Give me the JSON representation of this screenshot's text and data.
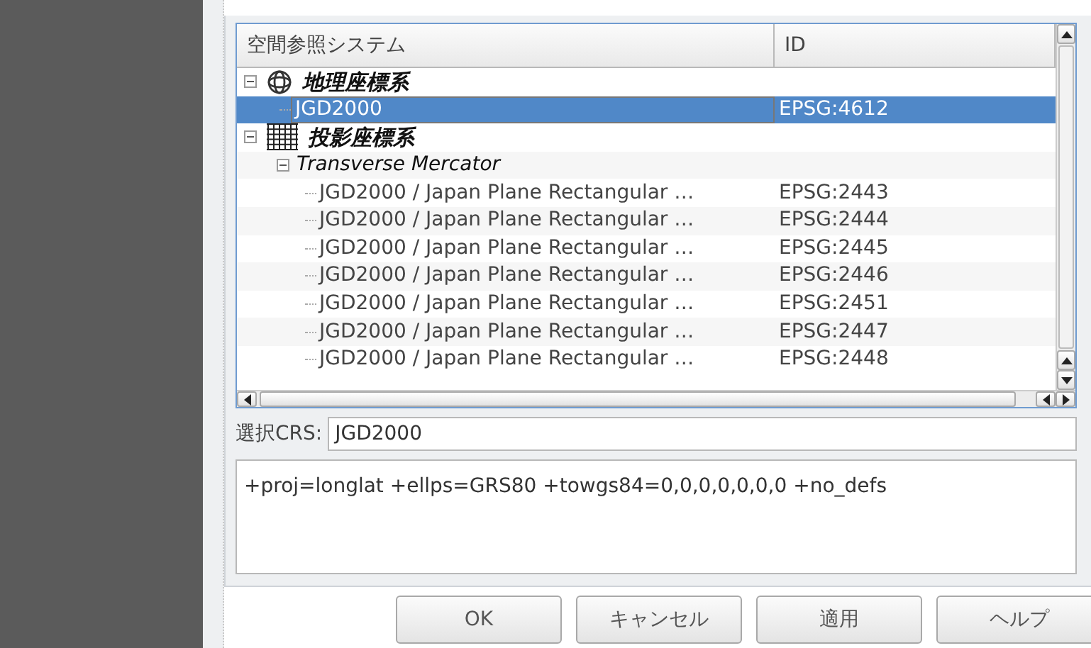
{
  "tree": {
    "columns": [
      "空間参照システム",
      "ID"
    ],
    "items": [
      {
        "kind": "geographic",
        "label": "地理座標系",
        "expanded": true,
        "selected": false,
        "children": [
          {
            "kind": "crs",
            "label": "JGD2000",
            "id": "EPSG:4612",
            "selected": true
          }
        ]
      },
      {
        "kind": "projected",
        "label": "投影座標系",
        "expanded": true,
        "selected": false,
        "children": [
          {
            "kind": "method",
            "label": "Transverse Mercator",
            "expanded": true,
            "selected": false,
            "children": [
              {
                "kind": "crs",
                "label": "JGD2000 / Japan Plane Rectangular …",
                "id": "EPSG:2443",
                "selected": false
              },
              {
                "kind": "crs",
                "label": "JGD2000 / Japan Plane Rectangular …",
                "id": "EPSG:2444",
                "selected": false
              },
              {
                "kind": "crs",
                "label": "JGD2000 / Japan Plane Rectangular …",
                "id": "EPSG:2445",
                "selected": false
              },
              {
                "kind": "crs",
                "label": "JGD2000 / Japan Plane Rectangular …",
                "id": "EPSG:2446",
                "selected": false
              },
              {
                "kind": "crs",
                "label": "JGD2000 / Japan Plane Rectangular …",
                "id": "EPSG:2451",
                "selected": false
              },
              {
                "kind": "crs",
                "label": "JGD2000 / Japan Plane Rectangular …",
                "id": "EPSG:2447",
                "selected": false
              },
              {
                "kind": "crs",
                "label": "JGD2000 / Japan Plane Rectangular …",
                "id": "EPSG:2448",
                "selected": false
              }
            ]
          }
        ]
      }
    ]
  },
  "selected_crs": {
    "label": "選択CRS:",
    "value": "JGD2000"
  },
  "proj_definition": "+proj=longlat +ellps=GRS80 +towgs84=0,0,0,0,0,0,0 +no_defs",
  "buttons": [
    {
      "label": "OK"
    },
    {
      "label": "キャンセル"
    },
    {
      "label": "適用"
    },
    {
      "label": "ヘルプ"
    }
  ]
}
